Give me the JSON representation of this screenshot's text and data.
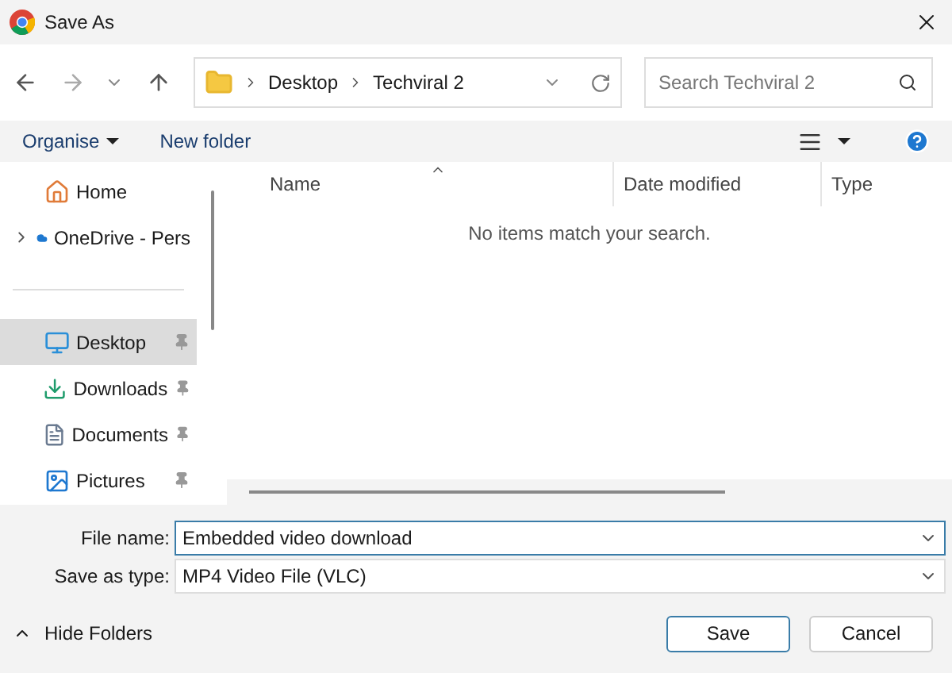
{
  "window": {
    "title": "Save As"
  },
  "address_bar": {
    "path": [
      "Desktop",
      "Techviral 2"
    ]
  },
  "search": {
    "placeholder": "Search Techviral 2"
  },
  "toolbar": {
    "organise": "Organise",
    "new_folder": "New folder"
  },
  "sidebar": {
    "items": [
      {
        "label": "Home",
        "kind": "home",
        "selected": false,
        "pinned": false,
        "expandable": false
      },
      {
        "label": "OneDrive - Pers",
        "kind": "cloud",
        "selected": false,
        "pinned": false,
        "expandable": true
      },
      {
        "label": "Desktop",
        "kind": "desktop",
        "selected": true,
        "pinned": true,
        "expandable": false
      },
      {
        "label": "Downloads",
        "kind": "downloads",
        "selected": false,
        "pinned": true,
        "expandable": false
      },
      {
        "label": "Documents",
        "kind": "documents",
        "selected": false,
        "pinned": true,
        "expandable": false
      },
      {
        "label": "Pictures",
        "kind": "pictures",
        "selected": false,
        "pinned": true,
        "expandable": false
      }
    ]
  },
  "table": {
    "columns": [
      "Name",
      "Date modified",
      "Type"
    ],
    "empty_message": "No items match your search."
  },
  "file_name": {
    "label": "File name:",
    "value": "Embedded video download"
  },
  "save_as_type": {
    "label": "Save as type:",
    "value": "MP4 Video File (VLC)"
  },
  "footer": {
    "hide_folders": "Hide Folders",
    "buttons": [
      "Save",
      "Cancel"
    ]
  }
}
